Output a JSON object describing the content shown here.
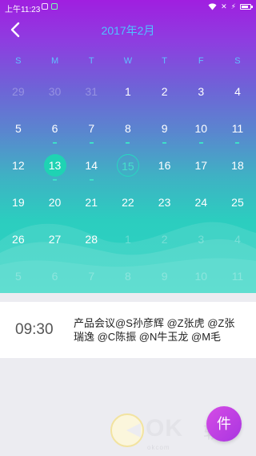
{
  "status_bar": {
    "time": "上午11:23"
  },
  "header": {
    "title": "2017年2月",
    "back_icon": "chevron-left-icon"
  },
  "calendar": {
    "weekdays": [
      "S",
      "M",
      "T",
      "W",
      "T",
      "F",
      "S"
    ],
    "weeks": [
      [
        {
          "d": "29",
          "other": true
        },
        {
          "d": "30",
          "other": true
        },
        {
          "d": "31",
          "other": true
        },
        {
          "d": "1"
        },
        {
          "d": "2"
        },
        {
          "d": "3"
        },
        {
          "d": "4"
        }
      ],
      [
        {
          "d": "5"
        },
        {
          "d": "6",
          "event": true
        },
        {
          "d": "7",
          "event": true
        },
        {
          "d": "8",
          "event": true
        },
        {
          "d": "9",
          "event": true
        },
        {
          "d": "10",
          "event": true
        },
        {
          "d": "11",
          "event": true
        }
      ],
      [
        {
          "d": "12"
        },
        {
          "d": "13",
          "selected": true,
          "event": true
        },
        {
          "d": "14",
          "event": true
        },
        {
          "d": "15",
          "today": true
        },
        {
          "d": "16"
        },
        {
          "d": "17"
        },
        {
          "d": "18"
        }
      ],
      [
        {
          "d": "19"
        },
        {
          "d": "20"
        },
        {
          "d": "21"
        },
        {
          "d": "22"
        },
        {
          "d": "23"
        },
        {
          "d": "24"
        },
        {
          "d": "25"
        }
      ],
      [
        {
          "d": "26"
        },
        {
          "d": "27"
        },
        {
          "d": "28"
        },
        {
          "d": "1",
          "other": true
        },
        {
          "d": "2",
          "other": true
        },
        {
          "d": "3",
          "other": true
        },
        {
          "d": "4",
          "other": true
        }
      ],
      [
        {
          "d": "5",
          "other": true
        },
        {
          "d": "6",
          "other": true
        },
        {
          "d": "7",
          "other": true
        },
        {
          "d": "8",
          "other": true
        },
        {
          "d": "9",
          "other": true
        },
        {
          "d": "10",
          "other": true
        },
        {
          "d": "11",
          "other": true
        }
      ]
    ]
  },
  "event": {
    "time": "09:30",
    "title": "产品会议@S孙彦辉 @Z张虎 @Z张瑞逸 @C陈振 @N牛玉龙 @M毛"
  },
  "watermark": {
    "text": "OK",
    "url": "okcom",
    "cn": "软件"
  },
  "fab": {
    "label": "件",
    "icon": "add-event-icon"
  },
  "colors": {
    "accent": "#1fd3b3",
    "title": "#4fc3ff",
    "fab": "#c041e4"
  }
}
